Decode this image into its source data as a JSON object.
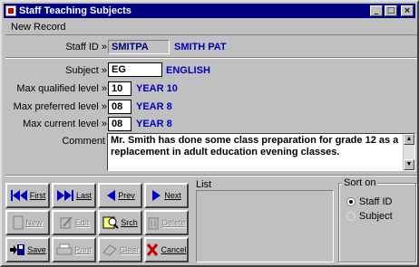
{
  "window": {
    "title": "Staff Teaching Subjects"
  },
  "mode": "New Record",
  "form": {
    "staff_id_label": "Staff ID »",
    "staff_id": "SMITPA",
    "staff_name": "SMITH PAT",
    "subject_label": "Subject »",
    "subject": "EG",
    "subject_name": "ENGLISH",
    "max_qualified_label": "Max qualified level »",
    "max_qualified": "10",
    "max_qualified_desc": "YEAR 10",
    "max_preferred_label": "Max preferred level »",
    "max_preferred": "08",
    "max_preferred_desc": "YEAR 8",
    "max_current_label": "Max current level »",
    "max_current": "08",
    "max_current_desc": "YEAR 8",
    "comment_label": "Comment",
    "comment": "Mr. Smith has done some class preparation for grade 12 as a replacement in adult education evening classes."
  },
  "nav_buttons": {
    "first": "First",
    "last": "Last",
    "prev": "Prev",
    "next": "Next",
    "new": "New",
    "edit": "Edit",
    "srch": "Srch",
    "delete": "Delete",
    "save": "Save",
    "print": "Print",
    "clear": "Clear",
    "cancel": "Cancel"
  },
  "list": {
    "label": "List"
  },
  "sort": {
    "label": "Sort on",
    "options": [
      "Staff ID",
      "Subject"
    ],
    "selected": "Staff ID"
  },
  "colors": {
    "titlebar": "#000080",
    "desc_text": "#0000c0",
    "face": "#c0c0c0"
  }
}
